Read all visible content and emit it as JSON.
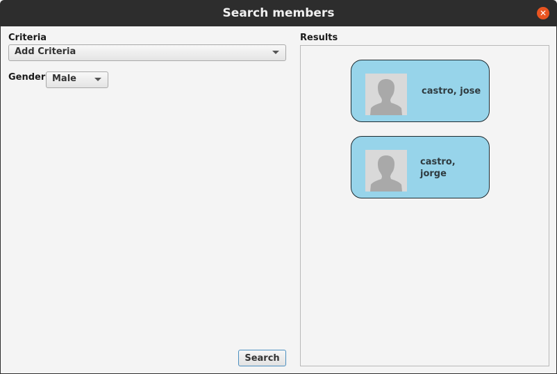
{
  "window": {
    "title": "Search members"
  },
  "criteria": {
    "label": "Criteria",
    "dropdown_value": "Add Criteria"
  },
  "gender": {
    "label": "Gender",
    "selected": "Male"
  },
  "results": {
    "label": "Results",
    "members": [
      {
        "name": "castro, jose"
      },
      {
        "name": "castro,\njorge"
      }
    ]
  },
  "actions": {
    "search_label": "Search"
  },
  "colors": {
    "card_bg": "#97d4ea",
    "close_button": "#e95420",
    "titlebar": "#2d2d2d"
  },
  "icons": {
    "close": "close-icon",
    "avatar": "person-silhouette-icon",
    "dropdown": "chevron-down-icon"
  }
}
